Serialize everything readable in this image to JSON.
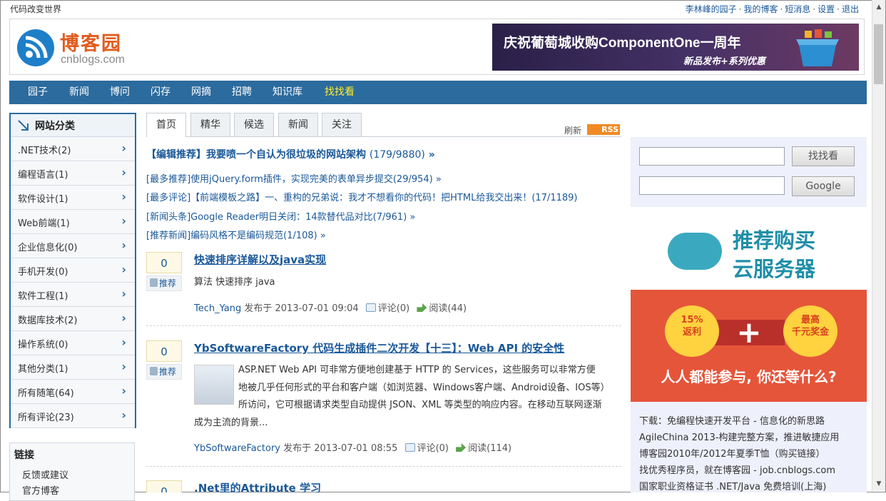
{
  "topbar": {
    "site_tag": "代码改变世界",
    "user_links": [
      "李林峰的园子",
      "我的博客",
      "短消息",
      "设置",
      "退出"
    ]
  },
  "header": {
    "logo_title": "博客园",
    "logo_sub": "cnblogs.com",
    "banner_title": "庆祝葡萄城收购ComponentOne一周年",
    "banner_sub": "新品发布+系列优惠"
  },
  "nav": {
    "items": [
      "园子",
      "新闻",
      "博问",
      "闪存",
      "网摘",
      "招聘",
      "知识库",
      "找找看"
    ],
    "highlight_color": "#ffef2a",
    "bg_color": "#2c6b9e"
  },
  "sidebar": {
    "title": "网站分类",
    "items": [
      ".NET技术(2)",
      "编程语言(1)",
      "软件设计(1)",
      "Web前端(1)",
      "企业信息化(0)",
      "手机开发(0)",
      "软件工程(1)",
      "数据库技术(2)",
      "操作系统(0)",
      "其他分类(1)",
      "所有随笔(64)",
      "所有评论(23)"
    ],
    "links_title": "链接",
    "links": [
      "反馈或建议",
      "官方博客"
    ]
  },
  "tabs": {
    "items": [
      "首页",
      "精华",
      "候选",
      "新闻",
      "关注"
    ],
    "active": "首页",
    "refresh": "刷新",
    "rss": "RSS"
  },
  "featured": {
    "main": "【编辑推荐】我要喷一个自认为很垃圾的网站架构",
    "main_count": "(179/9880)",
    "main_more": "»",
    "lines": [
      "[最多推荐]使用jQuery.form插件，实现完美的表单异步提交(29/954) »",
      "[最多评论]【前端模板之路】一、重构的兄弟说：我才不想看你的代码！把HTML给我交出来！(17/1189)",
      "[新闻头条]Google Reader明日关闭：14款替代品对比(7/961) »",
      "[推荐新闻]编码风格不是编码规范(1/108) »"
    ]
  },
  "posts": [
    {
      "votes": "0",
      "digg": "推荐",
      "title": "快速排序详解以及java实现",
      "summary": [
        "算法 快速排序 java"
      ],
      "author": "Tech_Yang",
      "posted": "发布于 2013-07-01 09:04",
      "comments": "评论(0)",
      "reads": "阅读(44)"
    },
    {
      "votes": "0",
      "digg": "推荐",
      "title": "YbSoftwareFactory 代码生成插件二次开发【十三】：Web API 的安全性",
      "summary": [
        "ASP.NET Web API 可非常方便地创建基于 HTTP 的 Services，这些服务可以非常方便",
        "地被几乎任何形式的平台和客户端（如浏览器、Windows客户端、Android设备、IOS等）",
        "所访问，它可根据请求类型自动提供 JSON、XML 等类型的响应内容。在移动互联网逐渐",
        "成为主流的背景..."
      ],
      "author": "YbSoftwareFactory",
      "posted": "发布于 2013-07-01 08:55",
      "comments": "评论(0)",
      "reads": "阅读(114)"
    },
    {
      "votes": "0",
      "title": ".Net里的Attribute 学习"
    }
  ],
  "right": {
    "search_btn_1": "找找看",
    "search_btn_2": "Google",
    "ad_line1": "推荐购买",
    "ad_line2": "云服务器",
    "ad_badge1": "15%\n返利",
    "ad_badge2": "最高\n千元奖金",
    "ad_plus": "+",
    "ad_slogan": "人人都能参与, 你还等什么?",
    "links": [
      "下载：免编程快速开发平台 - 信息化的新思路",
      "AgileChina 2013-构建完整方案，推进敏捷应用",
      "博客园2010年/2012年夏季T恤（购买链接）",
      "找优秀程序员，就在博客园 - job.cnblogs.com",
      "国家职业资格证书 .NET/Java 免费培训(上海)"
    ]
  }
}
